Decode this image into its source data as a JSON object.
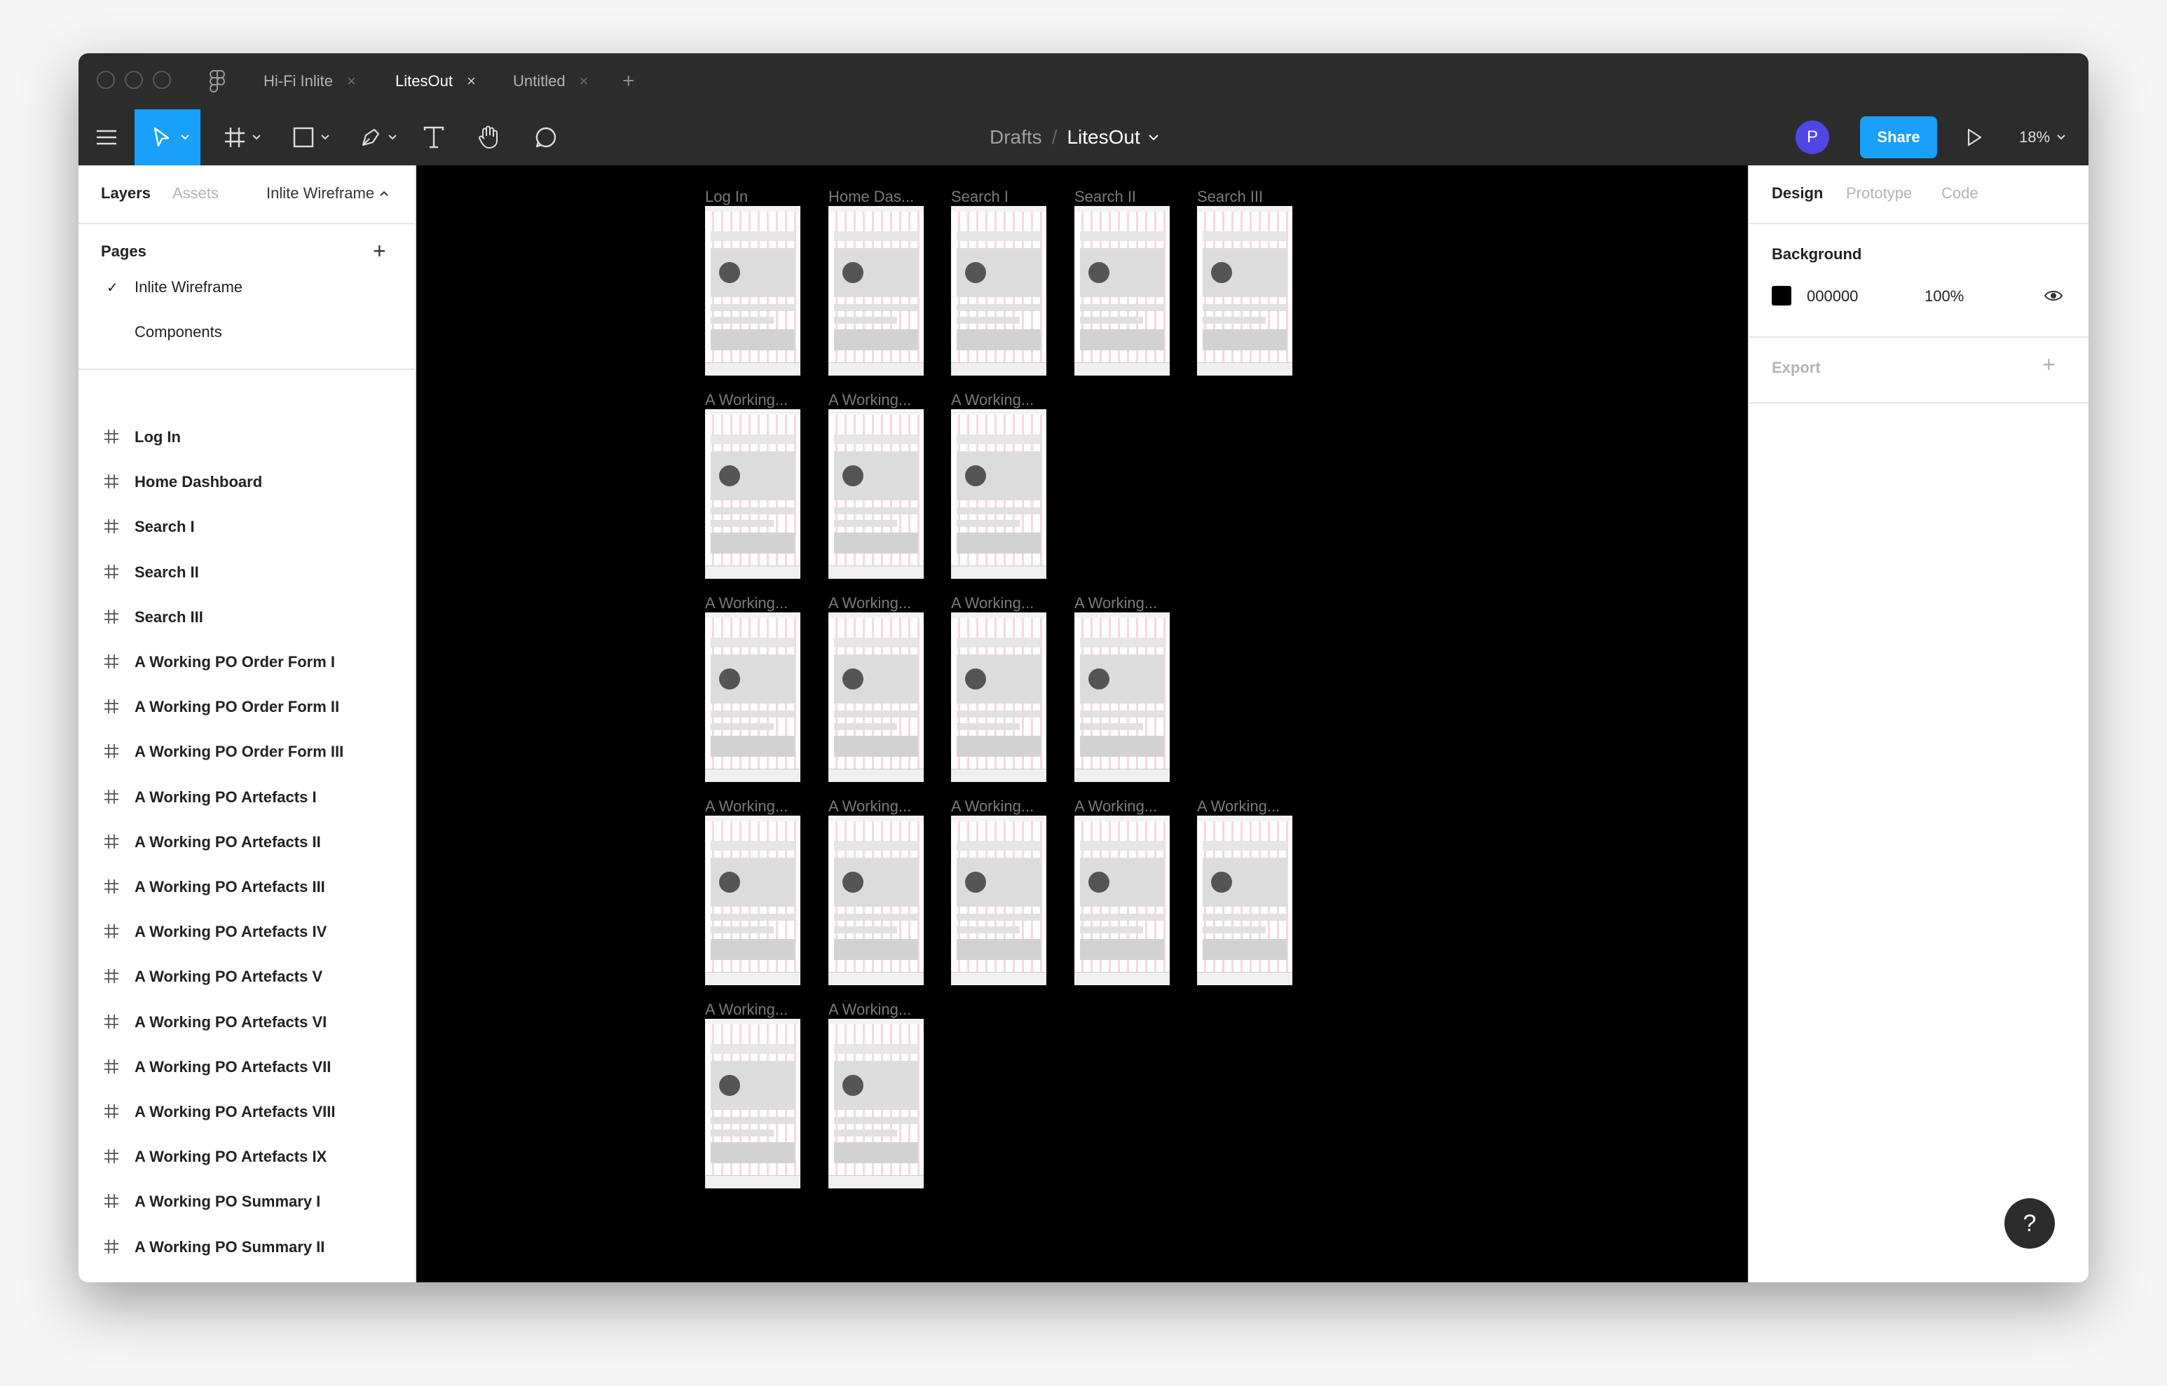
{
  "tabs": [
    {
      "label": "Hi-Fi Inlite",
      "active": false
    },
    {
      "label": "LitesOut",
      "active": true
    },
    {
      "label": "Untitled",
      "active": false
    }
  ],
  "breadcrumb": {
    "parent": "Drafts",
    "separator": "/",
    "current": "LitesOut"
  },
  "user": {
    "avatar_letter": "P"
  },
  "toolbar": {
    "share_label": "Share",
    "zoom": "18%"
  },
  "left_panel": {
    "tabs": [
      "Layers",
      "Assets"
    ],
    "page_selector": "Inlite Wireframe",
    "pages_title": "Pages",
    "pages": [
      {
        "label": "Inlite Wireframe",
        "selected": true
      },
      {
        "label": "Components",
        "selected": false
      }
    ],
    "layers": [
      "Log In",
      "Home Dashboard",
      "Search I",
      "Search II",
      "Search III",
      "A Working PO Order Form I",
      "A Working PO Order Form II",
      "A Working PO Order Form III",
      "A Working PO Artefacts I",
      "A Working PO Artefacts II",
      "A Working PO Artefacts III",
      "A Working PO Artefacts IV",
      "A Working PO Artefacts V",
      "A Working PO Artefacts VI",
      "A Working PO Artefacts VII",
      "A Working PO Artefacts VIII",
      "A Working PO Artefacts IX",
      "A Working PO Summary I",
      "A Working PO Summary II"
    ]
  },
  "canvas": {
    "background": "#000000",
    "frame_rows": [
      [
        "Log In",
        "Home Das...",
        "Search I",
        "Search II",
        "Search III"
      ],
      [
        "A Working...",
        "A Working...",
        "A Working..."
      ],
      [
        "A Working...",
        "A Working...",
        "A Working...",
        "A Working..."
      ],
      [
        "A Working...",
        "A Working...",
        "A Working...",
        "A Working...",
        "A Working..."
      ],
      [
        "A Working...",
        "A Working..."
      ]
    ]
  },
  "right_panel": {
    "tabs": [
      "Design",
      "Prototype",
      "Code"
    ],
    "background_title": "Background",
    "background_hex": "000000",
    "background_opacity": "100%",
    "export_label": "Export"
  },
  "help_label": "?",
  "colors": {
    "accent": "#18a0fb",
    "avatar": "#4f46e5",
    "chrome": "#2c2c2c"
  }
}
